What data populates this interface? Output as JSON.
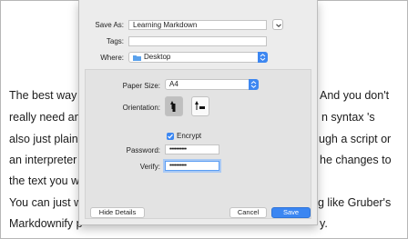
{
  "background_doc": {
    "lines": [
      {
        "left": "The best way t",
        "right": "And you don't"
      },
      {
        "left": "really need any",
        "right": "n syntax 's"
      },
      {
        "left": "also just plain t",
        "right": "ugh a script or"
      },
      {
        "left": "an interpreter c",
        "right": "he changes to"
      },
      {
        "left": "the text you w",
        "right": ""
      },
      {
        "left": "You can just w",
        "right": "g like Gruber's"
      },
      {
        "left": "Markdownify p",
        "right": "y."
      }
    ]
  },
  "save_dialog": {
    "save_as_label": "Save As:",
    "save_as_value": "Learning Markdown",
    "tags_label": "Tags:",
    "tags_value": "",
    "where_label": "Where:",
    "where_value": "Desktop",
    "paper_size_label": "Paper Size:",
    "paper_size_value": "A4",
    "orientation_label": "Orientation:",
    "encrypt_label": "Encrypt",
    "encrypt_checked": true,
    "password_label": "Password:",
    "password_value": "••••••••••",
    "verify_label": "Verify:",
    "verify_value": "••••••••••",
    "hide_details_label": "Hide Details",
    "cancel_label": "Cancel",
    "save_label": "Save"
  },
  "colors": {
    "accent": "#3b86f2",
    "sheet_bg": "#ececec",
    "inner_panel_bg": "#e3e3e3"
  },
  "icons": [
    "chevron-down-icon",
    "folder-icon",
    "updown-arrows-icon",
    "portrait-icon",
    "landscape-icon",
    "checkmark-icon"
  ]
}
